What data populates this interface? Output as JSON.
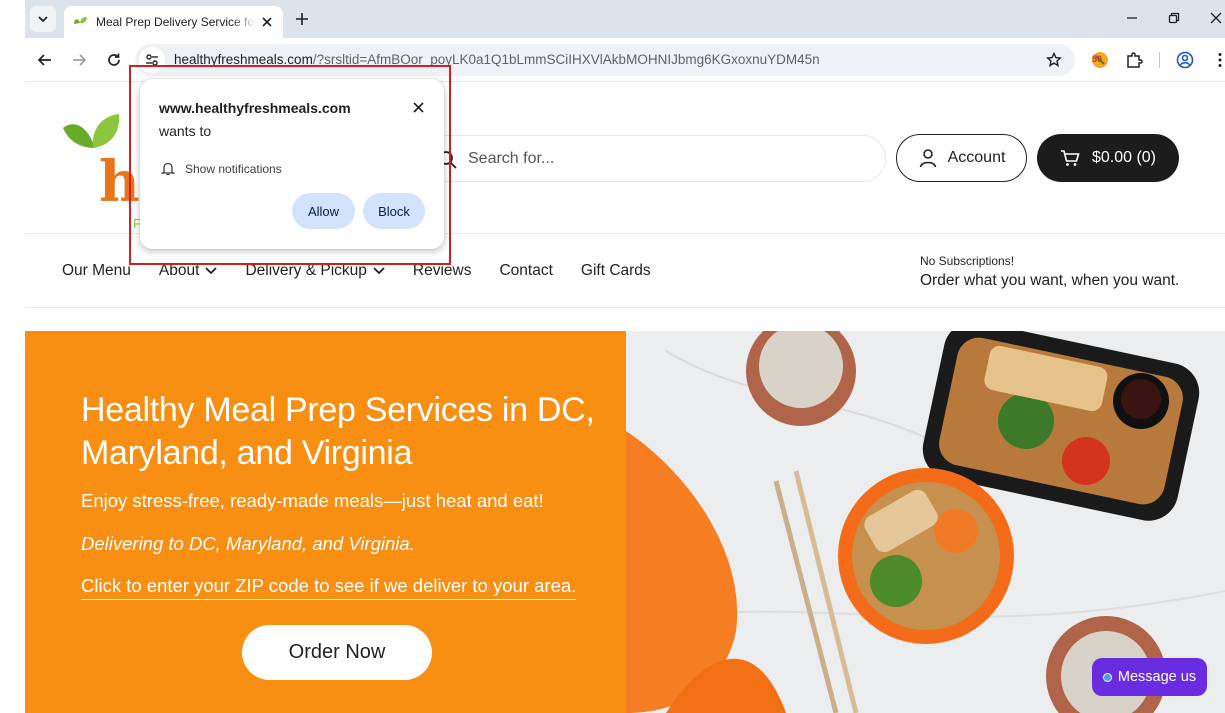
{
  "browser": {
    "tab_title": "Meal Prep Delivery Service for W",
    "url_host": "healthyfreshmeals.com",
    "url_path": "/?srsltid=AfmBOor_poyLK0a1Q1bLmmSCiIHXVlAkbMOHNIJbmg6KGxoxnuYDM45n",
    "ext_badge": "50"
  },
  "site": {
    "logo_text": "he",
    "logo_sub": "F",
    "search_placeholder": "Search for...",
    "account_label": "Account",
    "cart_label": "$0.00 (0)"
  },
  "nav": {
    "items": [
      "Our Menu",
      "About",
      "Delivery & Pickup",
      "Reviews",
      "Contact",
      "Gift Cards"
    ]
  },
  "promo": {
    "small": "No Subscriptions!",
    "big": "Order what you want, when you want."
  },
  "hero": {
    "title": "Healthy Meal Prep Services in DC, Maryland, and Virginia",
    "subtitle": "Enjoy stress-free, ready-made meals—just heat and eat!",
    "italic": "Delivering to DC, Maryland, and Virginia.",
    "zip_link": "Click to enter your ZIP code to see if we deliver to your area.",
    "order_button": "Order Now"
  },
  "chat": {
    "label": "Message us"
  },
  "permission_popup": {
    "host": "www.healthyfreshmeals.com",
    "wants_to": "wants to",
    "permission": "Show notifications",
    "allow": "Allow",
    "block": "Block"
  },
  "colors": {
    "hero_orange": "#f88f12",
    "cart_dark": "#1c1c1c",
    "chat_purple": "#6a2ce0",
    "popup_button": "#d3e3fd",
    "highlight_red": "#d21f25"
  }
}
